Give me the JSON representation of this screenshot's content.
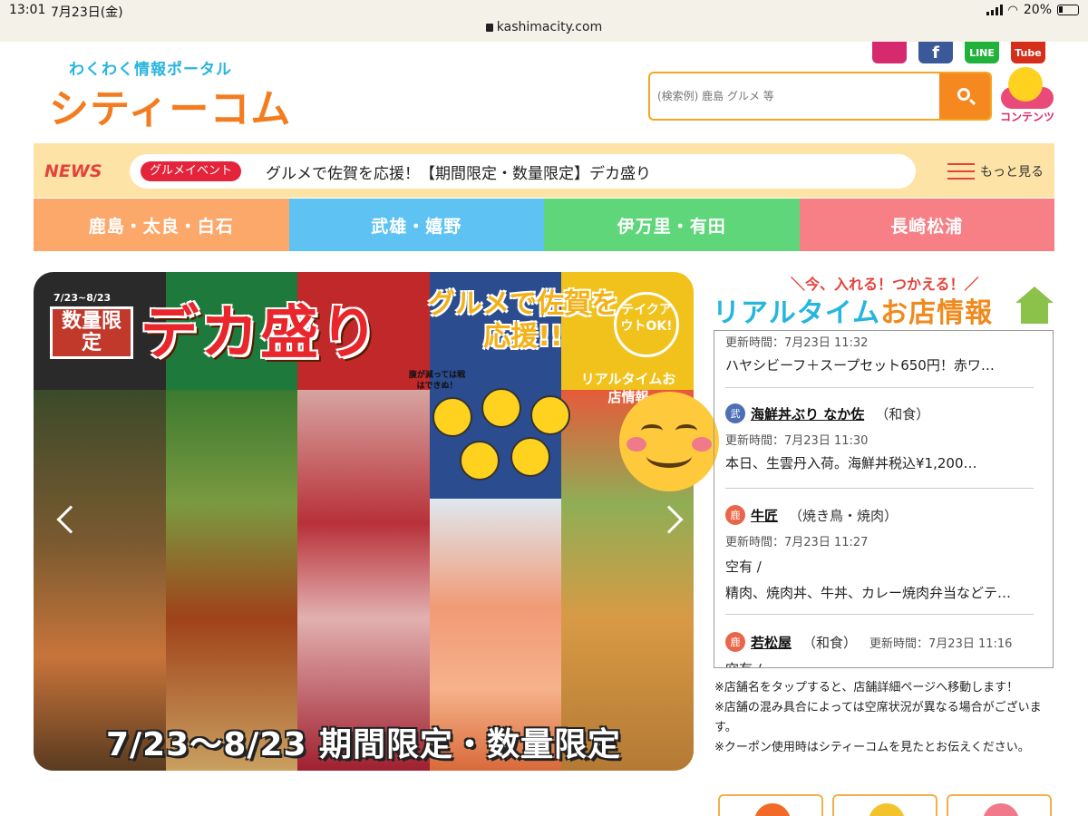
{
  "status_bar": {
    "time": "13:01",
    "date": "7月23日(金)",
    "battery": "20%",
    "url": "kashimacity.com"
  },
  "header": {
    "tagline": "わくわく情報ポータル",
    "logo": "シティーコム",
    "socials": [
      {
        "name": "instagram-icon",
        "label": ""
      },
      {
        "name": "facebook-icon",
        "label": "f"
      },
      {
        "name": "line-icon",
        "label": "LINE"
      },
      {
        "name": "youtube-icon",
        "label": "Tube"
      }
    ],
    "search_placeholder": "(検索例) 鹿島 グルメ 等",
    "mascot_label": "コンテンツ"
  },
  "news": {
    "label": "NEWS",
    "badge": "グルメイベント",
    "headline": "グルメで佐賀を応援！【期間限定・数量限定】デカ盛り",
    "more": "もっと見る"
  },
  "regions": [
    {
      "label": "鹿島・太良・白石",
      "color": "#fba86a"
    },
    {
      "label": "武雄・嬉野",
      "color": "#5ec2f2"
    },
    {
      "label": "伊万里・有田",
      "color": "#5fd67a"
    },
    {
      "label": "長崎松浦",
      "color": "#f77f86"
    }
  ],
  "banner": {
    "dates_small": "7/23~8/23",
    "qty_limited": "数量限定",
    "deka": "デカ盛り",
    "gourmet": "グルメで佐賀を応援!!",
    "takeout": "テイクアウトOK!",
    "realtime": "リアルタイムお店情報",
    "small_note": "腹が減っては戦はできぬ！",
    "period": "7/23～8/23 期間限定・数量限定",
    "stripe_colors": [
      "#2a2a2a",
      "#1e7a3c",
      "#c0282a",
      "#2b4c8f",
      "#f1c21b"
    ]
  },
  "realtime": {
    "subtitle": "＼今、入れる！つかえる！／",
    "title_blue": "リアルタイム",
    "title_orange": "お店情報",
    "entries": [
      {
        "meta": "更新時間：7月23日 11:32",
        "body": "ハヤシビーフ＋スープセット650円！赤ワ…"
      },
      {
        "area": "武",
        "shop": "海鮮丼ぶり なか佐",
        "genre": "（和食）",
        "meta": "更新時間：7月23日 11:30",
        "body": "本日、生雲丹入荷。海鮮丼税込¥1,200…"
      },
      {
        "area": "鹿",
        "shop": "牛匠",
        "genre": "（焼き鳥・焼肉）",
        "meta": "更新時間：7月23日 11:27",
        "body1": "空有 /",
        "body2": "精肉、焼肉丼、牛丼、カレー焼肉弁当などテ…"
      },
      {
        "area": "鹿",
        "shop": "若松屋",
        "genre": "（和食）",
        "meta": "更新時間：7月23日 11:16",
        "body": "空有 /"
      }
    ]
  },
  "notes": [
    "※店舗名をタップすると、店舗詳細ページへ移動します！",
    "※店舗の混み具合によっては空席状況が異なる場合がございます。",
    "※クーポン使用時はシティーコムを見たとお伝えください。"
  ]
}
